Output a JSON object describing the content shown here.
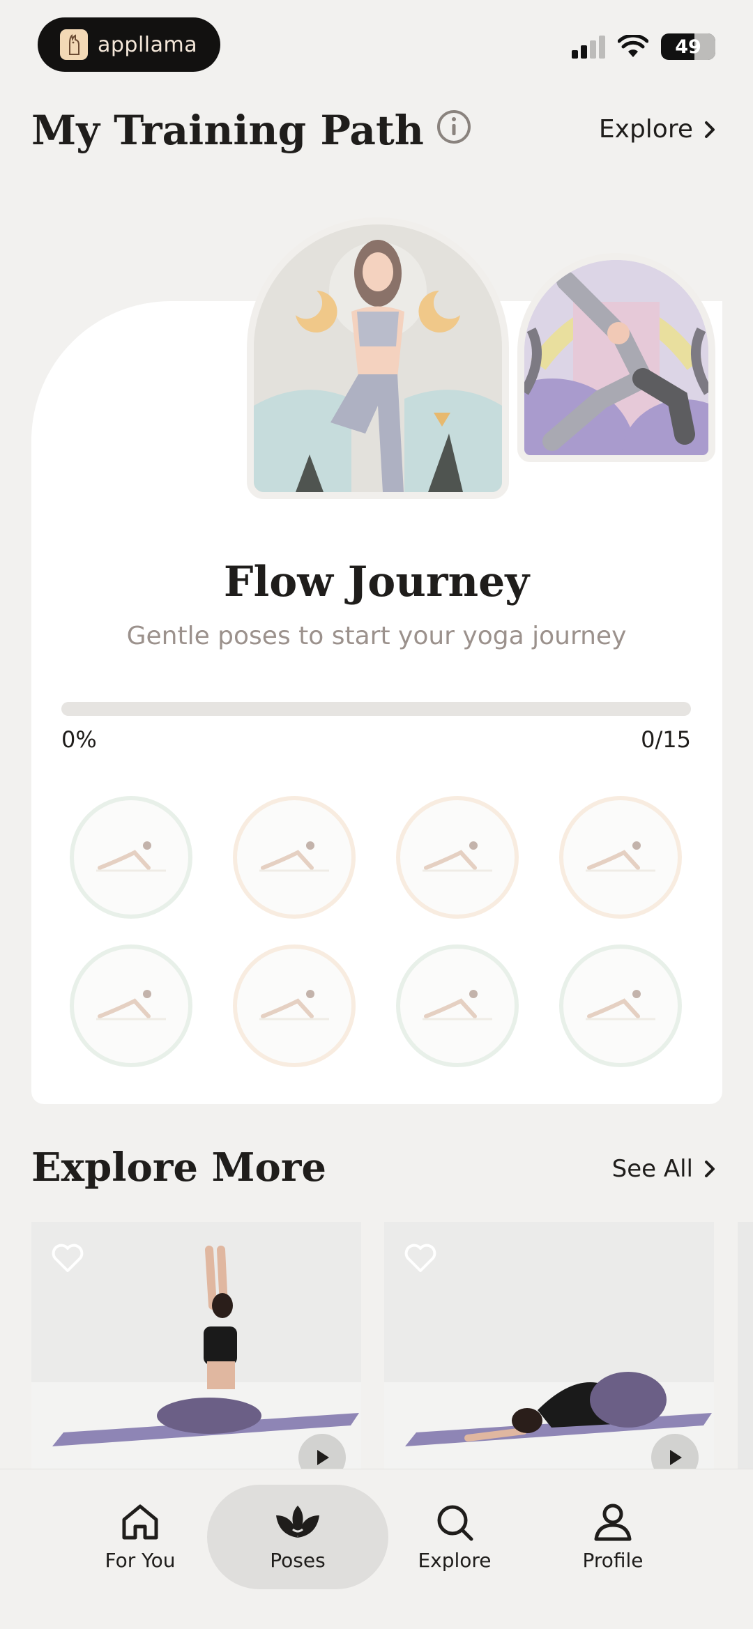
{
  "status_bar": {
    "app_name": "appllama",
    "battery": "49"
  },
  "header": {
    "title": "My Training Path",
    "explore_link": "Explore"
  },
  "journey": {
    "title": "Flow Journey",
    "subtitle": "Gentle poses to start your yoga journey",
    "progress_label": "0%",
    "progress_count": "0/15",
    "progress_fraction": 0,
    "poses": [
      {
        "name": "cat-cow-pose-icon",
        "tone": "green"
      },
      {
        "name": "cobra-pose-icon",
        "tone": "peach"
      },
      {
        "name": "thread-needle-pose-icon",
        "tone": "peach"
      },
      {
        "name": "staff-pose-icon",
        "tone": "peach"
      },
      {
        "name": "downward-dog-pose-icon",
        "tone": "green"
      },
      {
        "name": "child-pose-icon",
        "tone": "peach"
      },
      {
        "name": "reclined-pose-icon",
        "tone": "green"
      },
      {
        "name": "seated-twist-pose-icon",
        "tone": "green"
      }
    ]
  },
  "explore_more": {
    "title": "Explore More",
    "see_all": "See All"
  },
  "tabs": [
    {
      "label": "For You",
      "icon": "home-icon"
    },
    {
      "label": "Poses",
      "icon": "lotus-icon",
      "active": true
    },
    {
      "label": "Explore",
      "icon": "search-icon"
    },
    {
      "label": "Profile",
      "icon": "profile-icon"
    }
  ],
  "colors": {
    "background": "#f2f1ef",
    "card": "#ffffff",
    "accent_lavender": "#8e85b5",
    "muted_text": "#9b918c"
  }
}
